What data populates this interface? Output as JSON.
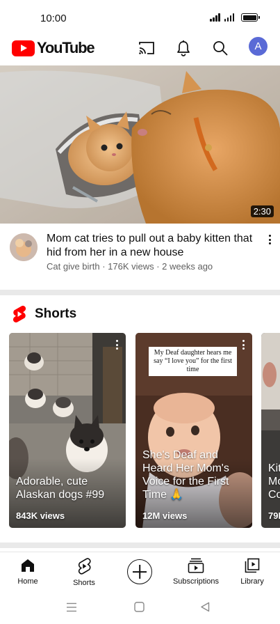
{
  "status_bar": {
    "time": "10:00"
  },
  "app_bar": {
    "logo_text": "YouTube",
    "account_initial": "A"
  },
  "featured_video": {
    "duration": "2:30",
    "title": "Mom cat tries to pull out a baby kitten that hid from her in a new house",
    "channel": "Cat give birth",
    "views": "176K views",
    "age": "2 weeks ago",
    "subtitle": "Cat give birth · 176K views · 2 weeks ago"
  },
  "shorts": {
    "heading": "Shorts",
    "items": [
      {
        "caption": "Adorable, cute Alaskan dogs #99",
        "views": "843K views"
      },
      {
        "caption": "She's Deaf and Heard Her Mom's Voice for the First Time 🙏",
        "views": "12M views",
        "overlay_text": "My Deaf daughter hears me say “I love you” for the first time"
      },
      {
        "caption": "Kit Mo Co",
        "views": "79K"
      }
    ]
  },
  "bottom_nav": {
    "items": [
      {
        "label": "Home",
        "icon": "home-icon",
        "active": true
      },
      {
        "label": "Shorts",
        "icon": "shorts-icon"
      },
      {
        "label": "",
        "icon": "create-icon"
      },
      {
        "label": "Subscriptions",
        "icon": "subscriptions-icon"
      },
      {
        "label": "Library",
        "icon": "library-icon"
      }
    ]
  },
  "colors": {
    "brand_red": "#ff0000",
    "account_avatar": "#5a6ad6",
    "text_primary": "#0f0f0f",
    "text_secondary": "#606060",
    "separator": "#e9e9e9"
  }
}
